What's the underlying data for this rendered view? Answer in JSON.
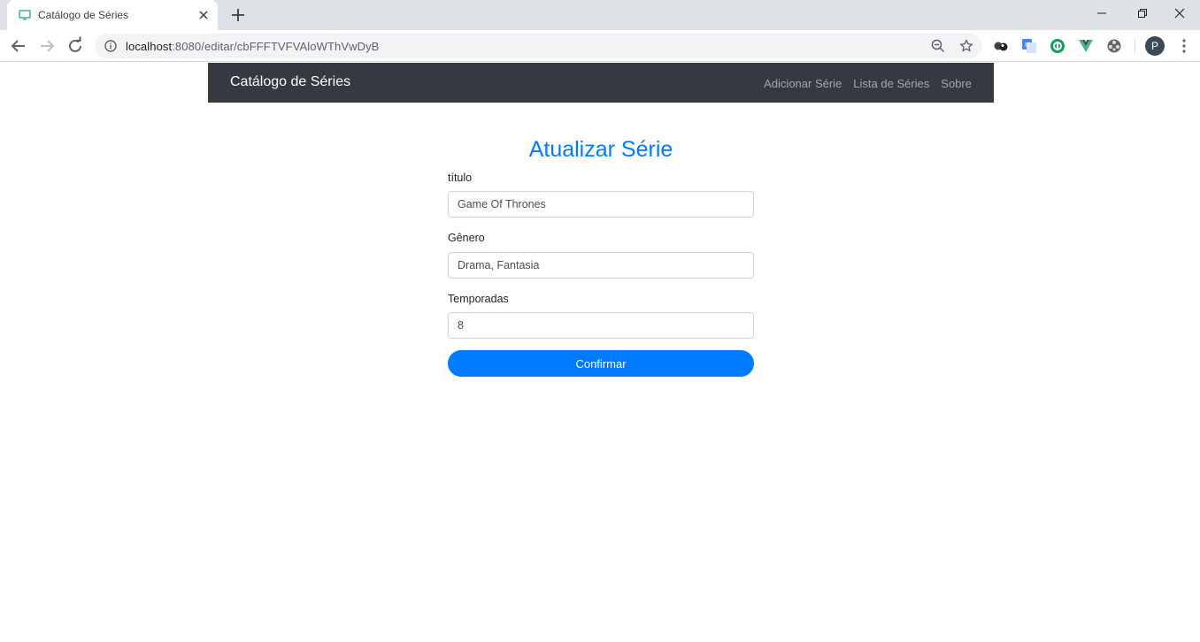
{
  "browser": {
    "tab_title": "Catálogo de Séries",
    "url_host": "localhost",
    "url_path": ":8080/editar/cbFFFTVFVAloWThVwDyB",
    "profile_initial": "P",
    "icons": [
      "monitor-favicon-icon",
      "close-icon",
      "plus-icon",
      "minimize-icon",
      "restore-icon",
      "close-window-icon",
      "back-icon",
      "forward-icon",
      "reload-icon",
      "info-icon",
      "zoom-icon",
      "star-icon",
      "extension-icon",
      "translate-icon",
      "extension-green-icon",
      "vue-devtools-icon",
      "extension-film-icon",
      "menu-dots-icon"
    ]
  },
  "navbar": {
    "brand": "Catálogo de Séries",
    "links": [
      "Adicionar Série",
      "Lista de Séries",
      "Sobre"
    ]
  },
  "form": {
    "title": "Atualizar Série",
    "fields": [
      {
        "label": "título",
        "value": "Game Of Thrones"
      },
      {
        "label": "Gênero",
        "value": "Drama, Fantasia"
      },
      {
        "label": "Temporadas",
        "value": "8"
      }
    ],
    "submit_label": "Confirmar"
  },
  "colors": {
    "accent": "#007bff",
    "navbar_bg": "#343a40",
    "tabstrip_bg": "#dee1e6"
  }
}
